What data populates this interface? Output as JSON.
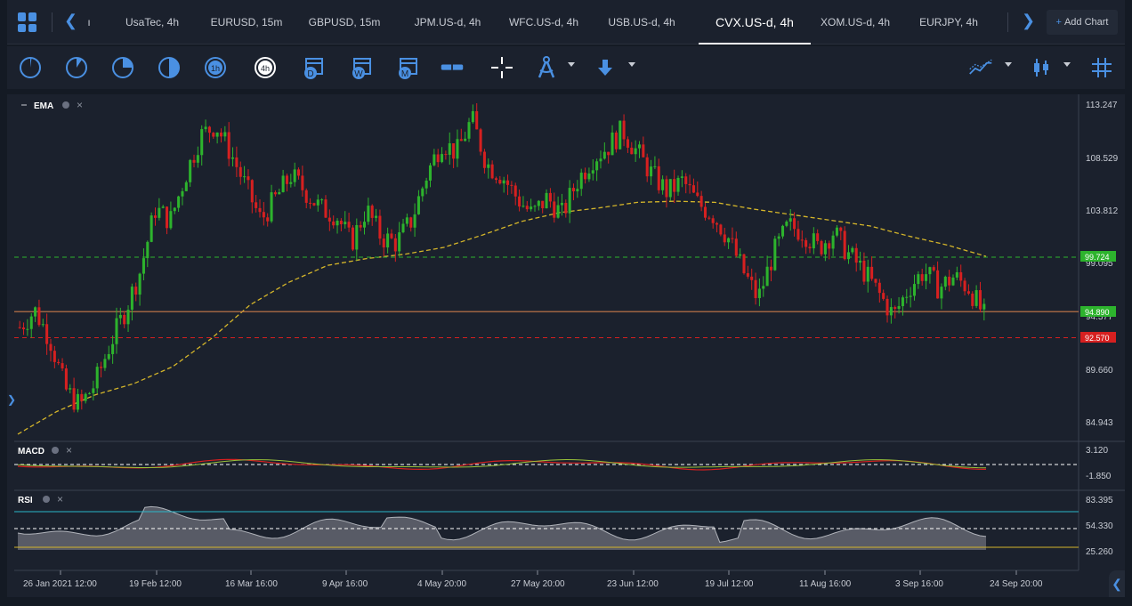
{
  "tabs": [
    {
      "label": "ı"
    },
    {
      "label": "UsaTec, 4h"
    },
    {
      "label": "EURUSD, 15m"
    },
    {
      "label": "GBPUSD, 15m"
    },
    {
      "label": "JPM.US-d, 4h"
    },
    {
      "label": "WFC.US-d, 4h"
    },
    {
      "label": "USB.US-d, 4h"
    },
    {
      "label": "CVX.US-d, 4h",
      "active": true
    },
    {
      "label": "XOM.US-d, 4h"
    },
    {
      "label": "EURJPY, 4h"
    }
  ],
  "add_chart_label": "Add Chart",
  "toolbar": {
    "timeframes": [
      "clock-1",
      "clock-2",
      "clock-3",
      "clock-4",
      "1h",
      "4h"
    ],
    "active_timeframe": "4h",
    "period_buttons": [
      "D",
      "W",
      "M"
    ]
  },
  "main_panel": {
    "indicator_label": "EMA",
    "price_axis": [
      "113.247",
      "108.529",
      "103.812",
      "99.095",
      "94.377",
      "89.660",
      "84.943"
    ],
    "ylim": [
      84.943,
      113.247
    ],
    "price_tags": [
      {
        "value": "99.724",
        "color": "#2db32d"
      },
      {
        "value": "94.890",
        "color": "#2db32d"
      },
      {
        "value": "92.570",
        "color": "#d62020"
      }
    ]
  },
  "macd_panel": {
    "label": "MACD",
    "axis": [
      "3.120",
      "-1.850"
    ]
  },
  "rsi_panel": {
    "label": "RSI",
    "axis": [
      "83.395",
      "54.330",
      "25.260"
    ]
  },
  "time_axis": [
    "26 Jan 2021 12:00",
    "19 Feb 12:00",
    "16 Mar 16:00",
    "9 Apr 16:00",
    "4 May 20:00",
    "27 May 20:00",
    "23 Jun 12:00",
    "19 Jul 12:00",
    "11 Aug 16:00",
    "3 Sep 16:00",
    "24 Sep 20:00"
  ],
  "colors": {
    "up": "#2db32d",
    "down": "#d62020",
    "ema": "#d4b52a",
    "accent": "#4a90e2",
    "rsi_line": "#2ab7c9"
  },
  "chart_data": {
    "type": "candlestick",
    "symbol": "CVX.US-d, 4h",
    "price_path": [
      93.5,
      95.0,
      92.5,
      88.0,
      86.5,
      88.5,
      92.0,
      95.0,
      98.5,
      104.0,
      103.0,
      107.0,
      110.5,
      111.5,
      109.0,
      106.0,
      103.0,
      105.0,
      107.0,
      105.5,
      104.0,
      103.5,
      101.0,
      104.0,
      101.5,
      101.0,
      103.0,
      107.0,
      110.0,
      109.0,
      112.0,
      108.0,
      107.0,
      105.0,
      103.5,
      105.0,
      103.5,
      106.5,
      108.5,
      109.5,
      111.0,
      109.0,
      107.0,
      105.5,
      106.5,
      104.5,
      103.5,
      101.5,
      98.5,
      96.0,
      100.0,
      102.5,
      102.0,
      100.5,
      102.0,
      100.0,
      98.5,
      96.5,
      94.5,
      97.0,
      98.5,
      97.0,
      98.0,
      97.0,
      94.5
    ],
    "ema": [
      84.0,
      86.0,
      87.5,
      88.5,
      90.0,
      92.5,
      95.5,
      97.5,
      99.0,
      99.6,
      100.0,
      100.6,
      101.7,
      102.9,
      103.7,
      104.1,
      104.6,
      104.7,
      104.6,
      104.0,
      103.5,
      103.0,
      102.5,
      101.6,
      100.8,
      99.8
    ],
    "lines": {
      "resistance": 99.724,
      "current": 94.89,
      "support": 92.57
    },
    "macd_range": [
      -1.85,
      3.12
    ],
    "rsi_range": [
      25.26,
      83.395
    ]
  }
}
